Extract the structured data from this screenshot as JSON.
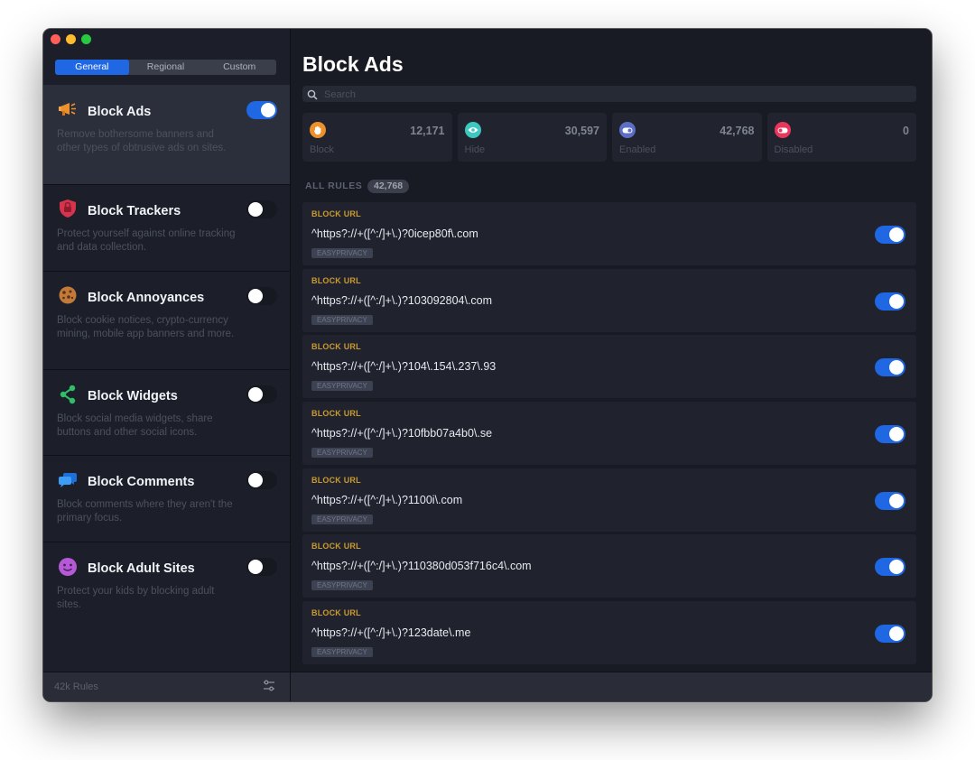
{
  "sidebar": {
    "tabs": [
      {
        "label": "General",
        "active": true
      },
      {
        "label": "Regional",
        "active": false
      },
      {
        "label": "Custom",
        "active": false
      }
    ],
    "categories": [
      {
        "title": "Block Ads",
        "description": "Remove bothersome banners and other types of obtrusive ads on sites.",
        "enabled": true,
        "icon": "megaphone-icon"
      },
      {
        "title": "Block Trackers",
        "description": "Protect yourself against online tracking and data collection.",
        "enabled": false,
        "icon": "shield-icon"
      },
      {
        "title": "Block Annoyances",
        "description": "Block cookie notices, crypto-currency mining, mobile app banners and more.",
        "enabled": false,
        "icon": "cookie-icon"
      },
      {
        "title": "Block Widgets",
        "description": "Block social media widgets, share buttons and other social icons.",
        "enabled": false,
        "icon": "share-icon"
      },
      {
        "title": "Block Comments",
        "description": "Block comments where they aren't the primary focus.",
        "enabled": false,
        "icon": "chat-bubbles-icon"
      },
      {
        "title": "Block Adult Sites",
        "description": "Protect your kids by blocking adult sites.",
        "enabled": false,
        "icon": "smiley-icon"
      }
    ],
    "footer": {
      "rules_count": "42k Rules",
      "icon": "filter-sliders-icon"
    }
  },
  "main": {
    "title": "Block Ads",
    "search": {
      "placeholder": "Search",
      "value": ""
    },
    "stats": [
      {
        "label": "Block",
        "count": "12,171",
        "color": "#f0902a",
        "icon": "hand-icon"
      },
      {
        "label": "Hide",
        "count": "30,597",
        "color": "#3cc7c1",
        "icon": "eye-icon"
      },
      {
        "label": "Enabled",
        "count": "42,768",
        "color": "#5d6fc4",
        "icon": "toggle-icon"
      },
      {
        "label": "Disabled",
        "count": "0",
        "color": "#e8365d",
        "icon": "stop-icon"
      }
    ],
    "all_rules_label": "ALL RULES",
    "all_rules_count": "42,768",
    "rules": [
      {
        "type": "BLOCK URL",
        "pattern": "^https?://+([^:/]+\\.)?0icep80f\\.com",
        "tag": "EASYPRIVACY",
        "enabled": true
      },
      {
        "type": "BLOCK URL",
        "pattern": "^https?://+([^:/]+\\.)?103092804\\.com",
        "tag": "EASYPRIVACY",
        "enabled": true
      },
      {
        "type": "BLOCK URL",
        "pattern": "^https?://+([^:/]+\\.)?104\\.154\\.237\\.93",
        "tag": "EASYPRIVACY",
        "enabled": true
      },
      {
        "type": "BLOCK URL",
        "pattern": "^https?://+([^:/]+\\.)?10fbb07a4b0\\.se",
        "tag": "EASYPRIVACY",
        "enabled": true
      },
      {
        "type": "BLOCK URL",
        "pattern": "^https?://+([^:/]+\\.)?1100i\\.com",
        "tag": "EASYPRIVACY",
        "enabled": true
      },
      {
        "type": "BLOCK URL",
        "pattern": "^https?://+([^:/]+\\.)?110380d053f716c4\\.com",
        "tag": "EASYPRIVACY",
        "enabled": true
      },
      {
        "type": "BLOCK URL",
        "pattern": "^https?://+([^:/]+\\.)?123date\\.me",
        "tag": "EASYPRIVACY",
        "enabled": true
      }
    ]
  }
}
